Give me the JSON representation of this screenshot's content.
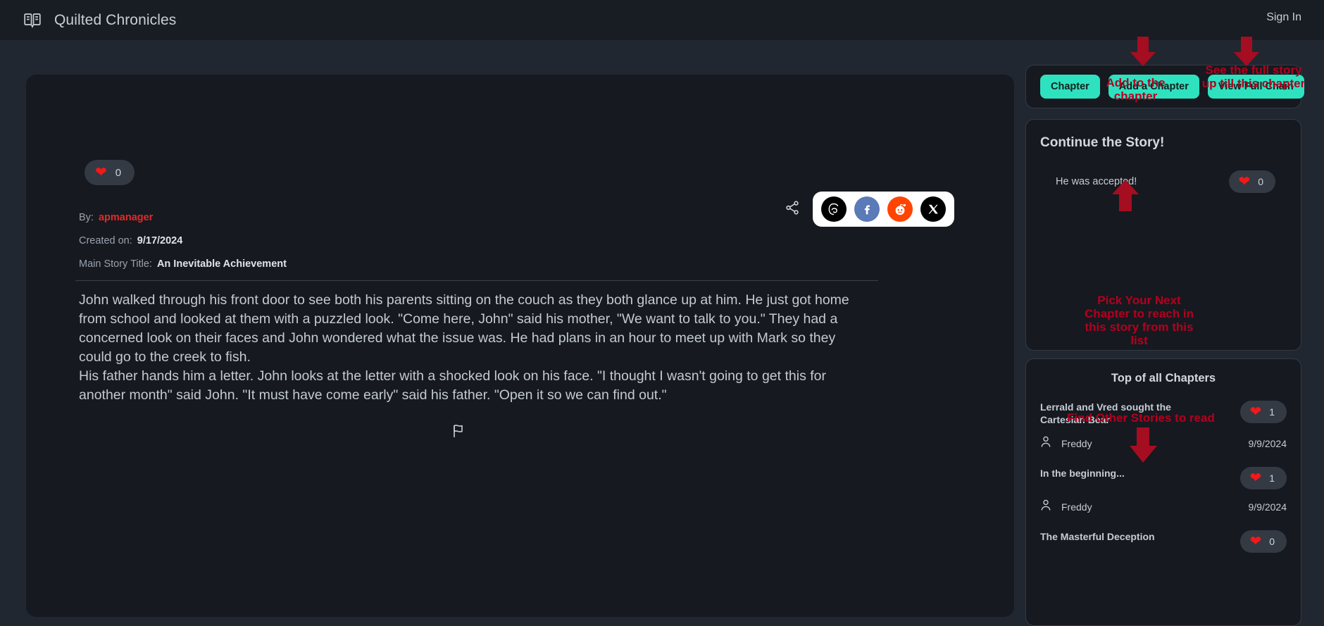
{
  "header": {
    "brand_icon": "open-book-icon",
    "brand_title": "Quilted Chronicles",
    "signin_label": "Sign In"
  },
  "main": {
    "like_count": "0",
    "share_icon": "share-icon",
    "share_buttons": [
      {
        "name": "threads",
        "glyph": "@"
      },
      {
        "name": "facebook",
        "glyph": "f"
      },
      {
        "name": "reddit",
        "glyph": ""
      },
      {
        "name": "x-twitter",
        "glyph": "X"
      }
    ],
    "by_label": "By:",
    "author": "apmanager",
    "created_label": "Created on:",
    "created_date": "9/17/2024",
    "story_title_label": "Main Story Title:",
    "story_title": "An Inevitable Achievement",
    "story_text": "John walked through his front door to see both his parents sitting on the couch as they both glance up at him. He just got home from school and looked at them with a puzzled look. \"Come here, John\" said his mother, \"We want to talk to you.\" They had a concerned look on their faces and John wondered what the issue was. He had plans in an hour to meet up with Mark so they could go to the creek to fish.\nHis father hands him a letter. John looks at the letter with a shocked look on his face. \"I thought I wasn't going to get this for another month\" said John. \"It must have come early\" said his father. \"Open it so we can find out.\"",
    "report_icon": "flag-icon"
  },
  "sidebar": {
    "actions": [
      {
        "label": "Chapter"
      },
      {
        "label": "Add a Chapter"
      },
      {
        "label": "View Full Chain"
      }
    ],
    "continue": {
      "title": "Continue the Story!",
      "items": [
        {
          "label": "He was accepted!",
          "likes": "0"
        }
      ]
    },
    "top_chapters": {
      "title": "Top of all Chapters",
      "items": [
        {
          "title": "Lerrald and Vred sought the Cartesian Bear",
          "likes": "1",
          "author": "Freddy",
          "date": "9/9/2024"
        },
        {
          "title": "In the beginning...",
          "likes": "1",
          "author": "Freddy",
          "date": "9/9/2024"
        },
        {
          "title": "The Masterful Deception",
          "likes": "0",
          "author": "",
          "date": ""
        }
      ]
    }
  },
  "annotations": [
    {
      "text": "Add to the chapter"
    },
    {
      "text": "See the full story up till this chapter"
    },
    {
      "text": "Pick Your Next Chapter to reach in this story from this list"
    },
    {
      "text": "Find Other Stories to read"
    }
  ],
  "colors": {
    "page_bg": "#212730",
    "header_bg": "#181c23",
    "card_bg": "#16191f",
    "accent_teal": "#2ee2c0",
    "annotation_red": "#b3001f",
    "author_red": "#e02b2b",
    "heart_red": "#f41818"
  }
}
